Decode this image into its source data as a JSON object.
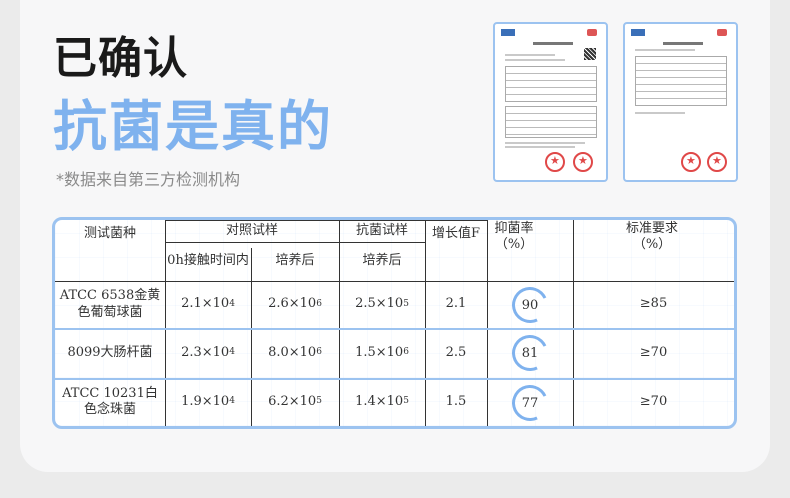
{
  "header": {
    "title": "已确认",
    "subtitle": "抗菌是真的",
    "note": "*数据来自第三方检测机构"
  },
  "reports": [
    {
      "name": "test-report-1"
    },
    {
      "name": "test-report-2"
    }
  ],
  "table": {
    "headers": {
      "strain": "测试菌种",
      "control": "对照试样",
      "control_0h": "0h接触时间内",
      "control_after": "培养后",
      "antibacterial": "抗菌试样",
      "antibacterial_after": "培养后",
      "growth": "增长值F",
      "rate": "抑菌率（%）",
      "standard": "标准要求（%）"
    },
    "rows": [
      {
        "strain": "ATCC 6538金黄色葡萄球菌",
        "c0_base": "2.1×10",
        "c0_exp": "4",
        "c1_base": "2.6×10",
        "c1_exp": "6",
        "a1_base": "2.5×10",
        "a1_exp": "5",
        "growth": "2.1",
        "rate": "90",
        "standard": "≥85"
      },
      {
        "strain": "8099大肠杆菌",
        "c0_base": "2.3×10",
        "c0_exp": "4",
        "c1_base": "8.0×10",
        "c1_exp": "6",
        "a1_base": "1.5×10",
        "a1_exp": "6",
        "growth": "2.5",
        "rate": "81",
        "standard": "≥70"
      },
      {
        "strain": "ATCC 10231白色念珠菌",
        "c0_base": "1.9×10",
        "c0_exp": "4",
        "c1_base": "6.2×10",
        "c1_exp": "5",
        "a1_base": "1.4×10",
        "a1_exp": "5",
        "growth": "1.5",
        "rate": "77",
        "standard": "≥70"
      }
    ]
  }
}
